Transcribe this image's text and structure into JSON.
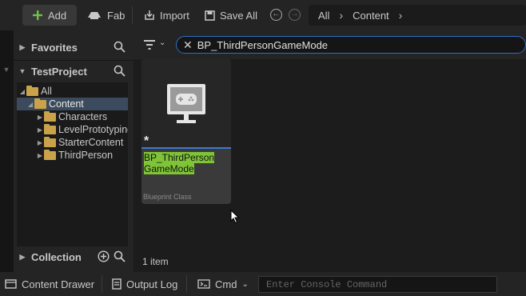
{
  "toolbar": {
    "add_label": "Add",
    "fab_label": "Fab",
    "import_label": "Import",
    "save_all_label": "Save All"
  },
  "breadcrumb": {
    "root": "All",
    "current": "Content"
  },
  "left_panel": {
    "favorites_label": "Favorites",
    "project_label": "TestProject",
    "collection_label": "Collection",
    "tree": [
      {
        "label": "All"
      },
      {
        "label": "Content"
      },
      {
        "label": "Characters"
      },
      {
        "label": "LevelPrototyping"
      },
      {
        "label": "StarterContent"
      },
      {
        "label": "ThirdPerson"
      }
    ]
  },
  "search": {
    "value": "BP_ThirdPersonGameMode"
  },
  "asset": {
    "name_line1": "BP_ThirdPerson",
    "name_line2": "GameMode",
    "type": "Blueprint Class",
    "modified_marker": "*"
  },
  "status": {
    "item_count": "1 item"
  },
  "bottom_bar": {
    "content_drawer": "Content Drawer",
    "output_log": "Output Log",
    "cmd_label": "Cmd",
    "console_placeholder": "Enter Console Command"
  },
  "colors": {
    "accent_blue": "#2f6ec5",
    "add_green": "#6cc24a",
    "folder": "#c9a24a",
    "highlight_green": "#7fc438"
  }
}
